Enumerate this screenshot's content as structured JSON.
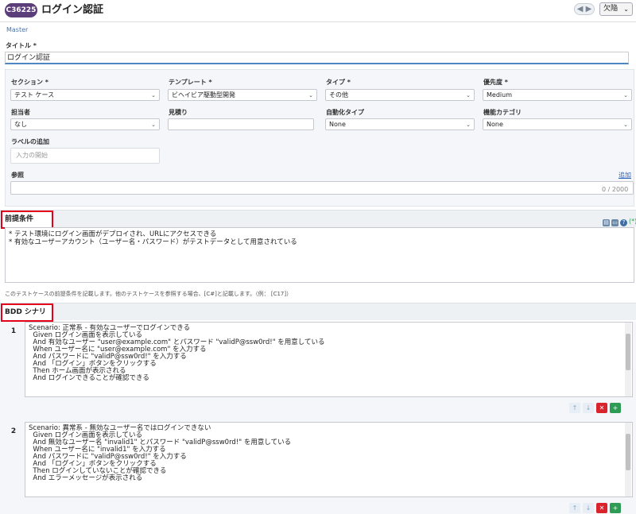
{
  "header": {
    "case_id": "C36225",
    "title": "ログイン認証",
    "nav_label": "◀ ▶",
    "section_select": "欠陥"
  },
  "master": {
    "label": "Master",
    "title_label": "タイトル *",
    "title_value": "ログイン認証"
  },
  "fields": {
    "section": {
      "label": "セクション *",
      "value": "テスト ケース"
    },
    "template": {
      "label": "テンプレート *",
      "value": "ビヘイビア駆動型開発"
    },
    "type": {
      "label": "タイプ *",
      "value": "その他"
    },
    "priority": {
      "label": "優先度 *",
      "value": "Medium"
    },
    "assignee": {
      "label": "担当者",
      "value": "なし"
    },
    "estimate": {
      "label": "見積り",
      "value": ""
    },
    "automation_type": {
      "label": "自動化タイプ",
      "value": "None"
    },
    "feature_category": {
      "label": "機能カテゴリ",
      "value": "None"
    },
    "labels": {
      "label": "ラベルの追加",
      "placeholder": "入力の開始"
    },
    "references": {
      "label": "参照",
      "add_link": "追加",
      "counter": "0 / 2000"
    }
  },
  "preconditions": {
    "label": "前提条件",
    "lines": [
      "* テスト環境にログイン画面がデプロイされ、URLにアクセスできる",
      "* 有効なユーザーアカウント（ユーザー名・パスワード）がテストデータとして用意されている"
    ],
    "hint": "このテストケースの前提条件を記載します。他のテストケースを参照する場合、[C#]と記載します。（例： [C17]）"
  },
  "bdd": {
    "label": "BDD シナリオ",
    "scenarios": [
      {
        "num": "1",
        "lines": [
          "Scenario: 正常系 - 有効なユーザーでログインできる",
          "  Given ログイン画面を表示している",
          "  And 有効なユーザー \"user@example.com\" とパスワード \"validP@ssw0rd!\" を用意している",
          "  When ユーザー名に \"user@example.com\" を入力する",
          "  And パスワードに \"validP@ssw0rd!\" を入力する",
          "  And 「ログイン」ボタンをクリックする",
          "  Then ホーム画面が表示される",
          "  And ログインできることが確認できる"
        ]
      },
      {
        "num": "2",
        "lines": [
          "Scenario: 異常系 - 無効なユーザー名ではログインできない",
          "  Given ログイン画面を表示している",
          "  And 無効なユーザー名 \"invalid1\" とパスワード \"validP@ssw0rd!\" を用意している",
          "  When ユーザー名に \"invalid1\" を入力する",
          "  And パスワードに \"validP@ssw0rd!\" を入力する",
          "  And 「ログイン」ボタンをクリックする",
          "  Then ログインしていないことが確認できる",
          "  And エラーメッセージが表示される"
        ]
      }
    ]
  },
  "icons": {
    "chevron": "⌄",
    "up": "↑",
    "down": "↓",
    "delete": "✕",
    "add": "+"
  },
  "colors": {
    "badge": "#5b3d7a",
    "highlight_border": "#e2001a",
    "delete": "#d9242e",
    "add": "#2e9b55",
    "link": "#3366bb"
  }
}
